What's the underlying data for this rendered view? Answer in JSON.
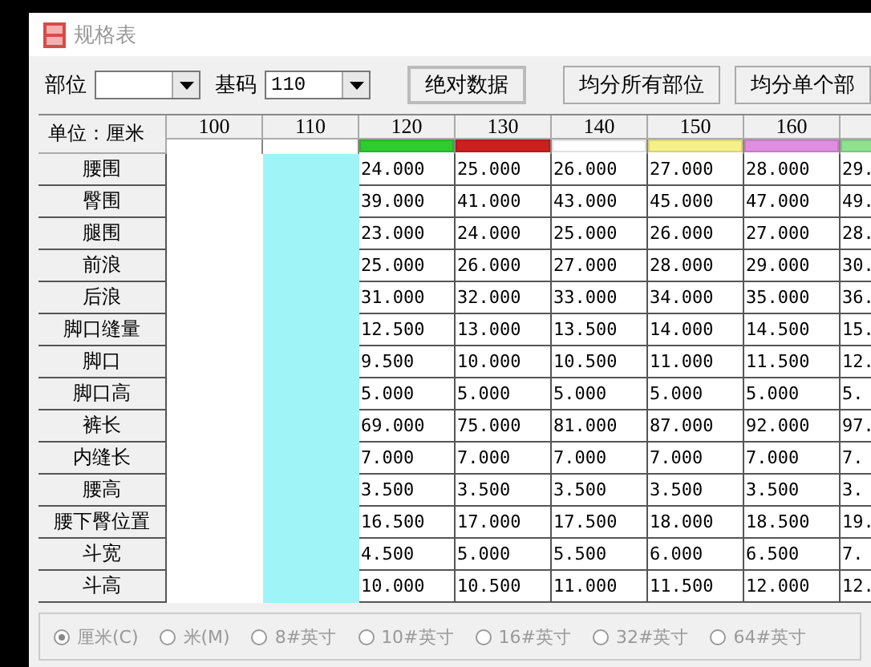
{
  "window": {
    "title": "规格表"
  },
  "toolbar": {
    "part_label": "部位",
    "base_label": "基码",
    "base_value": "110",
    "buttons": [
      "绝对数据",
      "均分所有部位",
      "均分单个部"
    ]
  },
  "table": {
    "corner": "单位：厘米",
    "columns": [
      {
        "label": "100",
        "kind": "blurred",
        "selected": false
      },
      {
        "label": "110",
        "kind": "blurred",
        "selected": true
      },
      {
        "label": "120",
        "kind": "data",
        "selected": false,
        "color": "#2ecc2e"
      },
      {
        "label": "130",
        "kind": "data",
        "selected": false,
        "color": "#cc1f1f"
      },
      {
        "label": "140",
        "kind": "data",
        "selected": false,
        "color": "#ffffff"
      },
      {
        "label": "150",
        "kind": "data",
        "selected": false,
        "color": "#f5f08a"
      },
      {
        "label": "160",
        "kind": "data",
        "selected": false,
        "color": "#e08ee0"
      },
      {
        "kind": "data",
        "selected": false,
        "color": "#8fe08f"
      }
    ],
    "rows": [
      {
        "label": "腰围",
        "values": [
          "24.000",
          "25.000",
          "26.000",
          "27.000",
          "28.000",
          "29."
        ]
      },
      {
        "label": "臀围",
        "values": [
          "39.000",
          "41.000",
          "43.000",
          "45.000",
          "47.000",
          "49."
        ]
      },
      {
        "label": "腿围",
        "values": [
          "23.000",
          "24.000",
          "25.000",
          "26.000",
          "27.000",
          "28."
        ]
      },
      {
        "label": "前浪",
        "values": [
          "25.000",
          "26.000",
          "27.000",
          "28.000",
          "29.000",
          "30."
        ]
      },
      {
        "label": "后浪",
        "values": [
          "31.000",
          "32.000",
          "33.000",
          "34.000",
          "35.000",
          "36."
        ]
      },
      {
        "label": "脚口缝量",
        "values": [
          "12.500",
          "13.000",
          "13.500",
          "14.000",
          "14.500",
          "15."
        ]
      },
      {
        "label": "脚口",
        "values": [
          "9.500",
          "10.000",
          "10.500",
          "11.000",
          "11.500",
          "12."
        ]
      },
      {
        "label": "脚口高",
        "values": [
          "5.000",
          "5.000",
          "5.000",
          "5.000",
          "5.000",
          "5."
        ]
      },
      {
        "label": "裤长",
        "values": [
          "69.000",
          "75.000",
          "81.000",
          "87.000",
          "92.000",
          "97."
        ]
      },
      {
        "label": "内缝长",
        "values": [
          "7.000",
          "7.000",
          "7.000",
          "7.000",
          "7.000",
          "7."
        ]
      },
      {
        "label": "腰高",
        "values": [
          "3.500",
          "3.500",
          "3.500",
          "3.500",
          "3.500",
          "3."
        ]
      },
      {
        "label": "腰下臀位置",
        "values": [
          "16.500",
          "17.000",
          "17.500",
          "18.000",
          "18.500",
          "19."
        ]
      },
      {
        "label": "斗宽",
        "values": [
          "4.500",
          "5.000",
          "5.500",
          "6.000",
          "6.500",
          "7."
        ]
      },
      {
        "label": "斗高",
        "values": [
          "10.000",
          "10.500",
          "11.000",
          "11.500",
          "12.000",
          "12."
        ]
      }
    ]
  },
  "units": [
    {
      "label": "厘米(C)",
      "selected": true
    },
    {
      "label": "米(M)",
      "selected": false
    },
    {
      "label": "8#英寸",
      "selected": false
    },
    {
      "label": "10#英寸",
      "selected": false
    },
    {
      "label": "16#英寸",
      "selected": false
    },
    {
      "label": "32#英寸",
      "selected": false
    },
    {
      "label": "64#英寸",
      "selected": false
    }
  ]
}
